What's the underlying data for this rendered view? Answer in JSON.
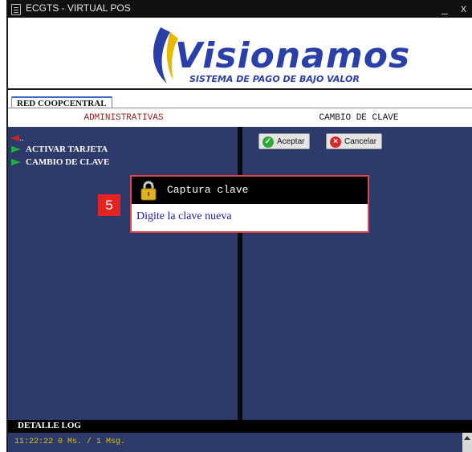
{
  "window": {
    "title": "ECGTS - VIRTUAL POS",
    "minimize_label": "_",
    "close_label": "x"
  },
  "logo": {
    "name": "Visionamos",
    "tagline": "SISTEMA DE PAGO DE BAJO VALOR"
  },
  "tabs": [
    {
      "label": "RED COOPCENTRAL"
    }
  ],
  "left_panel": {
    "header": "ADMINISTRATIVAS",
    "back_label": "..",
    "menu_items": [
      {
        "label": "ACTIVAR TARJETA",
        "icon": "green-arrow-icon"
      },
      {
        "label": "CAMBIO DE CLAVE",
        "icon": "green-arrow-icon"
      }
    ]
  },
  "right_panel": {
    "header": "CAMBIO DE CLAVE",
    "accept_label": "Aceptar",
    "cancel_label": "Cancelar"
  },
  "dialog": {
    "title": "Captura clave",
    "prompt": "Digite la clave nueva",
    "icon": "lock-icon"
  },
  "step_badge": "5",
  "log": {
    "title": "DETALLE LOG",
    "lines": [
      "11:22:22 0 Ms. / 1 Msg."
    ]
  },
  "colors": {
    "panel_bg": "#2e3a6a",
    "accent_green": "#1fb23a",
    "accent_red": "#e01d1d",
    "log_text": "#d8c200",
    "dialog_border": "#e04848"
  }
}
